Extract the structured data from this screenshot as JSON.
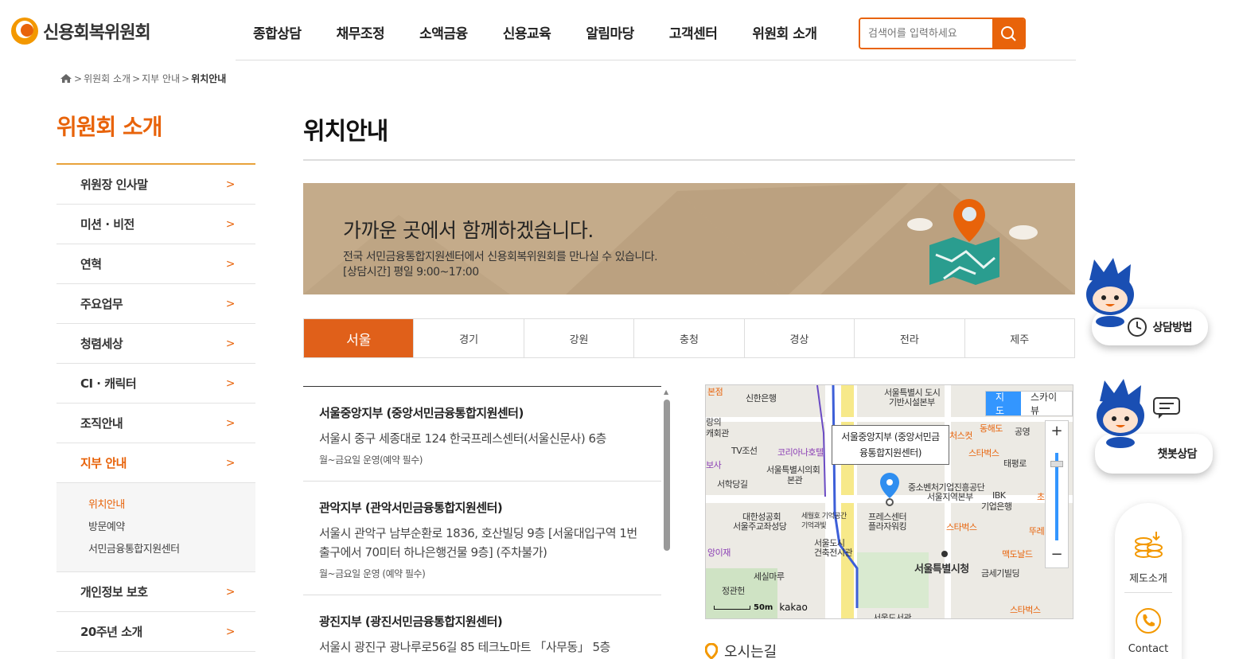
{
  "header": {
    "logo_text": "신용회복위원회",
    "nav": [
      "종합상담",
      "채무조정",
      "소액금융",
      "신용교육",
      "알림마당",
      "고객센터",
      "위원회 소개"
    ],
    "search_placeholder": "검색어를 입력하세요"
  },
  "breadcrumb": {
    "sep": ">",
    "items": [
      "위원회 소개",
      "지부 안내"
    ],
    "current": "위치안내"
  },
  "sidebar": {
    "title": "위원회 소개",
    "items": [
      {
        "label": "위원장 인사말"
      },
      {
        "label": "미션 · 비전"
      },
      {
        "label": "연혁"
      },
      {
        "label": "주요업무"
      },
      {
        "label": "청렴세상"
      },
      {
        "label": "CI · 캐릭터"
      },
      {
        "label": "조직안내"
      },
      {
        "label": "지부 안내"
      },
      {
        "label": "개인정보 보호"
      },
      {
        "label": "20주년 소개"
      }
    ],
    "chevron": ">",
    "sub_items": [
      "위치안내",
      "방문예약",
      "서민금융통합지원센터"
    ]
  },
  "main": {
    "title": "위치안내",
    "banner": {
      "headline": "가까운 곳에서 함께하겠습니다.",
      "desc1": "전국 서민금융통합지원센터에서 신용회복위원회를 만나실 수 있습니다.",
      "desc2": "[상담시간] 평일 9:00~17:00"
    },
    "tabs": [
      "서울",
      "경기",
      "강원",
      "충청",
      "경상",
      "전라",
      "제주"
    ],
    "branches": [
      {
        "name": "서울중앙지부 (중앙서민금융통합지원센터)",
        "addr": "서울시 중구 세종대로 124 한국프레스센터(서울신문사) 6층",
        "hours": "월~금요일 운영(예약 필수)"
      },
      {
        "name": "관악지부 (관악서민금융통합지원센터)",
        "addr": "서울시 관악구 남부순환로 1836, 호산빌딩 9층 [서울대입구역 1번 출구에서 70미터 하나은행건물 9층] (주차불가)",
        "hours": "월~금요일 운영 (예약 필수)"
      },
      {
        "name": "광진지부 (광진서민금융통합지원센터)",
        "addr": "서울시 광진구 광나루로56길 85 테크노마트 「사무동」 5층",
        "hours": ""
      }
    ],
    "directions": "오시는길"
  },
  "map": {
    "type_map": "지도",
    "type_sky": "스카이뷰",
    "zoom_in": "+",
    "zoom_out": "−",
    "info_line1": "서울중앙지부 (중앙서민금",
    "info_line2": "융통합지원센터)",
    "scale": "50m",
    "brand": "kakao",
    "labels": {
      "l1": "본점",
      "l2": "신한은행",
      "l3": "서울특별시 도시",
      "l4": "기반시설본부",
      "l5": "랑의",
      "l6": "캐회관",
      "l7": "TV조선",
      "l8": "코리아나호텔",
      "l9": "서울특별시의회",
      "l10": "본관",
      "l11": "서학당길",
      "l12": "보사",
      "l13": "대한성공회",
      "l14": "서울주교좌성당",
      "l15": "세월호 기억공간",
      "l16": "기억과빛",
      "l17": "프레스센터",
      "l18": "플라자워킹",
      "l19": "앙이재",
      "l20": "서울도시",
      "l21": "건축전시관",
      "l22": "세실마루",
      "l23": "정관헌",
      "l24": "서울특별시청",
      "l25": "중소벤처기업진흥공단",
      "l26": "서울지역본부",
      "l27": "IBK",
      "l28": "기업은행",
      "l29": "태평로",
      "l30": "공영",
      "l31": "동해도",
      "l32": "스타벅스",
      "l33": "스타벅스",
      "l34": "맥도날드",
      "l35": "금세기빌딩",
      "l36": "스타벅스",
      "l37": "서울도서관",
      "l38": "처스컷",
      "l39": "뚜레",
      "l40": "초"
    }
  },
  "floating": {
    "consult_method": "상담방법",
    "chatbot": "챗봇상담",
    "system_intro": "제도소개",
    "contact": "Contact"
  },
  "colors": {
    "accent": "#e8630a",
    "tab_active": "#e0601a",
    "banner_bg": "#c4ab8a",
    "map_blue": "#3396ff"
  }
}
